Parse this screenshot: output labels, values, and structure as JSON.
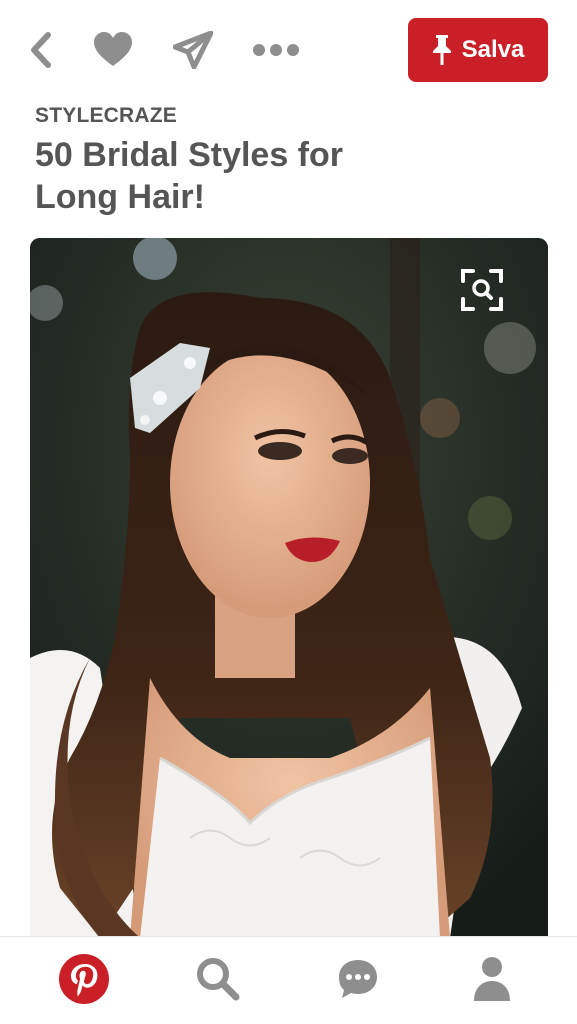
{
  "toolbar": {
    "back_icon": "chevron-left-icon",
    "like_icon": "heart-icon",
    "send_icon": "paper-plane-icon",
    "more_icon": "ellipsis-icon",
    "save_label": "Salva",
    "save_icon": "pushpin-icon"
  },
  "pin": {
    "source": "STYLECRAZE",
    "title": "50 Bridal Styles for Long Hair!",
    "image_alt": "Bride with long wavy dark hair, crystal hair clip and red lipstick, wearing a white lace dress",
    "visual_search_icon": "visual-search-icon"
  },
  "tabs": [
    {
      "name": "home",
      "icon": "pinterest-logo-icon"
    },
    {
      "name": "search",
      "icon": "search-icon"
    },
    {
      "name": "messages",
      "icon": "chat-bubble-icon"
    },
    {
      "name": "profile",
      "icon": "person-icon"
    }
  ],
  "colors": {
    "brand_red": "#cb1f27",
    "icon_gray": "#8e8e8e",
    "text_gray": "#555555"
  }
}
